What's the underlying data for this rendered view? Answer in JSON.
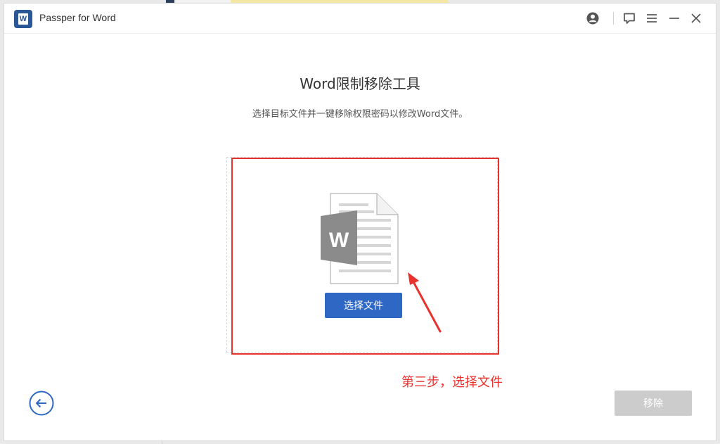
{
  "app": {
    "title": "Passper for Word",
    "logo_letter": "W"
  },
  "titlebar": {
    "icons": [
      "account-icon",
      "feedback-icon",
      "menu-icon",
      "minimize-icon",
      "close-icon"
    ]
  },
  "main": {
    "title": "Word限制移除工具",
    "subtitle": "选择目标文件并一键移除权限密码以修改Word文件。",
    "doc_badge_letter": "W",
    "select_button_label": "选择文件"
  },
  "annotation": {
    "step_text": "第三步，选择文件",
    "color": "#e8322e"
  },
  "footer": {
    "remove_button_label": "移除",
    "remove_button_enabled": false
  },
  "colors": {
    "accent": "#2e67c4",
    "logo": "#2b5797",
    "annotation_red": "#e8322e",
    "disabled": "#cccccc"
  }
}
